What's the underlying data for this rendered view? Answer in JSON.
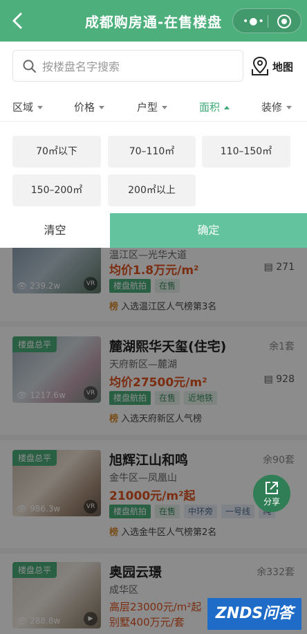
{
  "header": {
    "title": "成都购房通-在售楼盘",
    "menu_icon": "dots-icon",
    "close_icon": "target-icon"
  },
  "search": {
    "placeholder": "按楼盘名字搜索",
    "map_label": "地图"
  },
  "filters": [
    {
      "label": "区域",
      "active": false
    },
    {
      "label": "价格",
      "active": false
    },
    {
      "label": "户型",
      "active": false
    },
    {
      "label": "面积",
      "active": true
    },
    {
      "label": "装修",
      "active": false
    }
  ],
  "area_options": [
    "70㎡以下",
    "70–110㎡",
    "110–150㎡",
    "150–200㎡",
    "200㎡以上"
  ],
  "actions": {
    "clear": "清空",
    "confirm": "确定"
  },
  "listings": [
    {
      "title": "",
      "area": "温江区—光华大道",
      "price": "均价1.8万元/m²",
      "comments": "271",
      "views": "239.2w",
      "tags": [
        "楼盘航拍",
        "在售"
      ],
      "rank_text": "入选温江区人气榜第3名"
    },
    {
      "badge": "楼盘总平",
      "title": "麓湖熙华天玺(住宅)",
      "remain": "余1套",
      "area": "天府新区—麓湖",
      "price": "均价27500元/m²",
      "comments": "928",
      "views": "1217.6w",
      "tags": [
        "楼盘航拍",
        "在售",
        "近地铁"
      ],
      "rank_text": "入选天府新区人气榜"
    },
    {
      "badge": "楼盘总平",
      "title": "旭辉江山和鸣",
      "remain": "余90套",
      "area": "金牛区—凤凰山",
      "price": "21000元/m²起",
      "views": "986.3w",
      "tags": [
        "楼盘航拍",
        "在售",
        "中环旁",
        "一号线",
        "纯"
      ],
      "rank_text": "入选金牛区人气榜第2名"
    },
    {
      "badge": "楼盘总平",
      "title": "奥园云璟",
      "remain": "余332套",
      "area": "成华区",
      "price": "高层23000元/m²起",
      "price2": "别墅400万元/套",
      "views": "288.8w"
    }
  ],
  "rank_icon_text": "榜",
  "vr_text": "VR",
  "share_label": "分享",
  "watermark": "ZNDS问答",
  "colors": {
    "brand": "#4caf7c",
    "price": "#e0531f",
    "confirm": "#62c39e"
  }
}
